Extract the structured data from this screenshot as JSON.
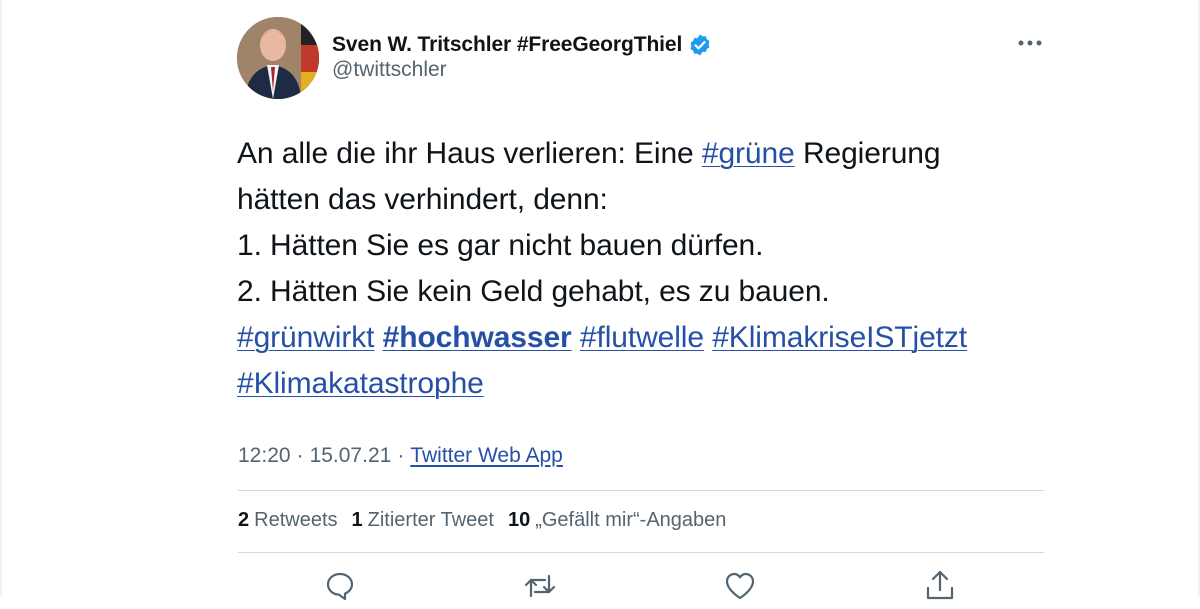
{
  "tweet": {
    "author": {
      "display_name": "Sven W. Tritschler #FreeGeorgThiel",
      "handle": "@twittschler",
      "verified": true
    },
    "text": {
      "line1_pre": "An alle die ihr Haus verlieren: Eine ",
      "line1_hashtag": "#grüne",
      "line1_post": " Regierung",
      "line2": "hätten das verhindert, denn:",
      "line3": "1. Hätten Sie es gar nicht bauen dürfen.",
      "line4": "2. Hätten Sie kein Geld gehabt, es zu bauen.",
      "hashtags_line5": [
        "#grünwirkt",
        "#hochwasser",
        "#flutwelle",
        "#KlimakriseISTjetzt"
      ],
      "hashtags_line6": [
        "#Klimakatastrophe"
      ]
    },
    "meta": {
      "time": "12:20",
      "separator": "·",
      "date": "15.07.21",
      "source": "Twitter Web App"
    },
    "stats": {
      "retweets_count": "2",
      "retweets_label": "Retweets",
      "quotes_count": "1",
      "quotes_label": "Zitierter Tweet",
      "likes_count": "10",
      "likes_label": "„Gefällt mir“-Angaben"
    },
    "actions": [
      "reply-icon",
      "retweet-icon",
      "like-icon",
      "share-icon"
    ],
    "colors": {
      "link": "#2550a6",
      "verified_badge": "#1d9bf0",
      "secondary_text": "#536471",
      "divider": "#cfd9de"
    }
  }
}
